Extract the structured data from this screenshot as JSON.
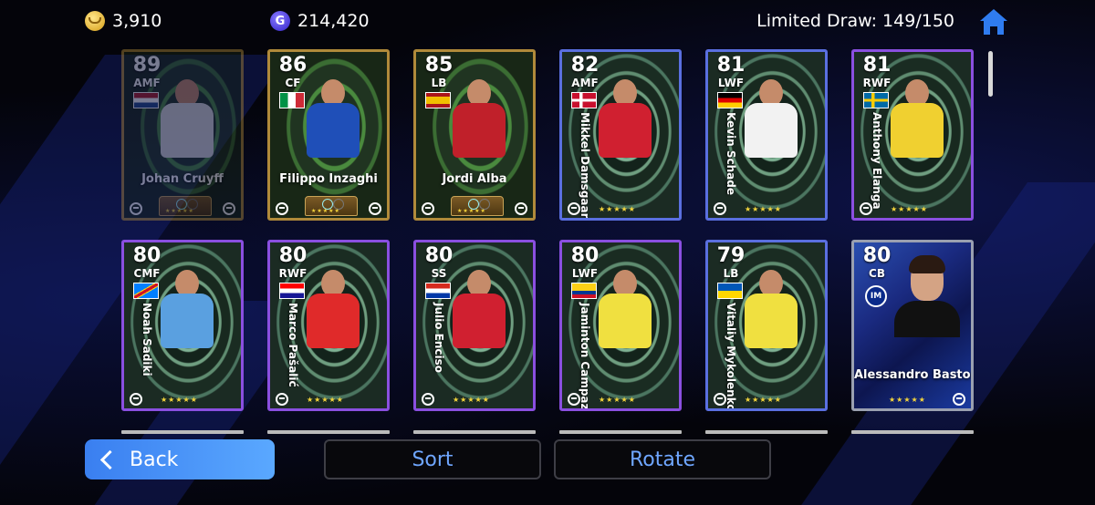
{
  "header": {
    "coins": "3,910",
    "gp": "214,420",
    "gp_icon_letter": "G",
    "limited_draw_label": "Limited Draw: 149/150",
    "home_icon": "home-icon"
  },
  "cards": [
    {
      "rating": "89",
      "position": "AMF",
      "name": "Johan Cruyff",
      "style": "gold",
      "flag": "netherlands",
      "jersey": "#d8d8d8",
      "shorts": "#ffffff",
      "dim": true
    },
    {
      "rating": "86",
      "position": "CF",
      "name": "Filippo Inzaghi",
      "style": "gold",
      "flag": "italy",
      "jersey": "#1f4fb8",
      "shorts": "#ffffff",
      "dim": false
    },
    {
      "rating": "85",
      "position": "LB",
      "name": "Jordi Alba",
      "style": "gold",
      "flag": "spain",
      "jersey": "#c0202a",
      "shorts": "#1a2a6a",
      "dim": false
    },
    {
      "rating": "82",
      "position": "AMF",
      "name": "Mikkel Damsgaard",
      "style": "blue",
      "flag": "denmark",
      "jersey": "#d02030",
      "shorts": "#ffffff",
      "dim": false
    },
    {
      "rating": "81",
      "position": "LWF",
      "name": "Kevin Schade",
      "style": "blue",
      "flag": "germany",
      "jersey": "#f2f2f2",
      "shorts": "#222222",
      "dim": false
    },
    {
      "rating": "81",
      "position": "RWF",
      "name": "Anthony Elanga",
      "style": "purple",
      "flag": "sweden",
      "jersey": "#f0d030",
      "shorts": "#1a3a9a",
      "dim": false
    },
    {
      "rating": "80",
      "position": "CMF",
      "name": "Noah Sadiki",
      "style": "purple",
      "flag": "dr-congo",
      "jersey": "#5aa0e0",
      "shorts": "#5aa0e0",
      "dim": false
    },
    {
      "rating": "80",
      "position": "RWF",
      "name": "Marco Pašalić",
      "style": "purple",
      "flag": "croatia",
      "jersey": "#e02a2a",
      "shorts": "#ffffff",
      "dim": false
    },
    {
      "rating": "80",
      "position": "SS",
      "name": "Julio Enciso",
      "style": "purple",
      "flag": "paraguay",
      "jersey": "#d02030",
      "shorts": "#1a3a9a",
      "dim": false
    },
    {
      "rating": "80",
      "position": "LWF",
      "name": "Jaminton Campaz",
      "style": "purple",
      "flag": "colombia",
      "jersey": "#f0e040",
      "shorts": "#1a3a9a",
      "dim": false
    },
    {
      "rating": "79",
      "position": "LB",
      "name": "Vitaliy Mykolenko",
      "style": "blue",
      "flag": "ukraine",
      "jersey": "#f0e040",
      "shorts": "#f0e040",
      "dim": false
    },
    {
      "rating": "80",
      "position": "CB",
      "name": "Alessandro Bastoni",
      "style": "silver",
      "flag": "",
      "club": "Inter",
      "jersey": "#111111",
      "shorts": "#111111",
      "dim": false
    }
  ],
  "stars": "★★★★★",
  "buttons": {
    "back": "Back",
    "sort": "Sort",
    "rotate": "Rotate"
  }
}
